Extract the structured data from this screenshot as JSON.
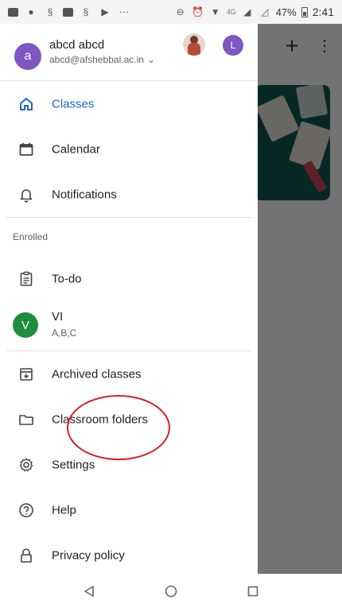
{
  "status_bar": {
    "network": "4G",
    "battery": "47%",
    "time": "2:41"
  },
  "account": {
    "avatar_letter": "a",
    "name": "abcd abcd",
    "email": "abcd@afshebbal.ac.in",
    "second_avatar_letter": "L"
  },
  "nav": {
    "classes": "Classes",
    "calendar": "Calendar",
    "notifications": "Notifications",
    "enrolled_header": "Enrolled",
    "todo": "To-do",
    "archived": "Archived classes",
    "folders": "Classroom folders",
    "settings": "Settings",
    "help": "Help",
    "privacy": "Privacy policy"
  },
  "class_item": {
    "letter": "V",
    "name": "VI",
    "subtitle": "A,B,C"
  },
  "colors": {
    "accent": "#1967d2",
    "account_avatar": "#7e57c2",
    "class_avatar": "#1e8e3e",
    "annotation": "#d61f26"
  }
}
